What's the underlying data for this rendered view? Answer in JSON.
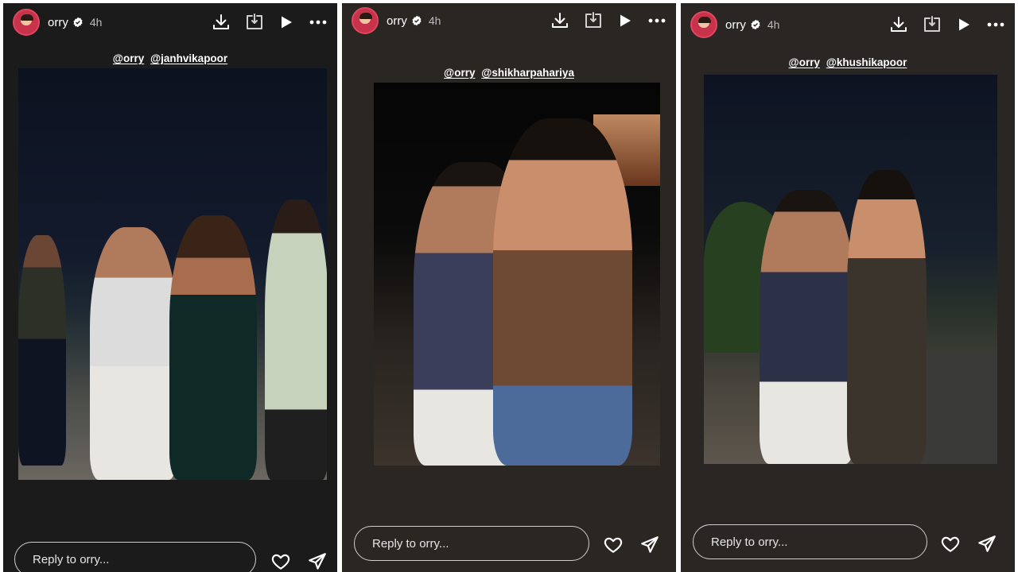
{
  "stories": [
    {
      "username": "orry",
      "time": "4h",
      "mentions": [
        "@orry",
        "@janhvikapoor"
      ],
      "reply_placeholder": "Reply to orry..."
    },
    {
      "username": "orry",
      "time": "4h",
      "mentions": [
        "@orry",
        "@shikharpahariya"
      ],
      "reply_placeholder": "Reply to orry..."
    },
    {
      "username": "orry",
      "time": "4h",
      "mentions": [
        "@orry",
        "@khushikapoor"
      ],
      "reply_placeholder": "Reply to orry..."
    }
  ],
  "icons": [
    "avatar",
    "verified-icon",
    "download-icon",
    "save-icon",
    "play-icon",
    "more-icon",
    "heart-icon",
    "send-icon"
  ],
  "colors": {
    "verified": "#ffffff",
    "accent_avatar": "#c8324a"
  }
}
